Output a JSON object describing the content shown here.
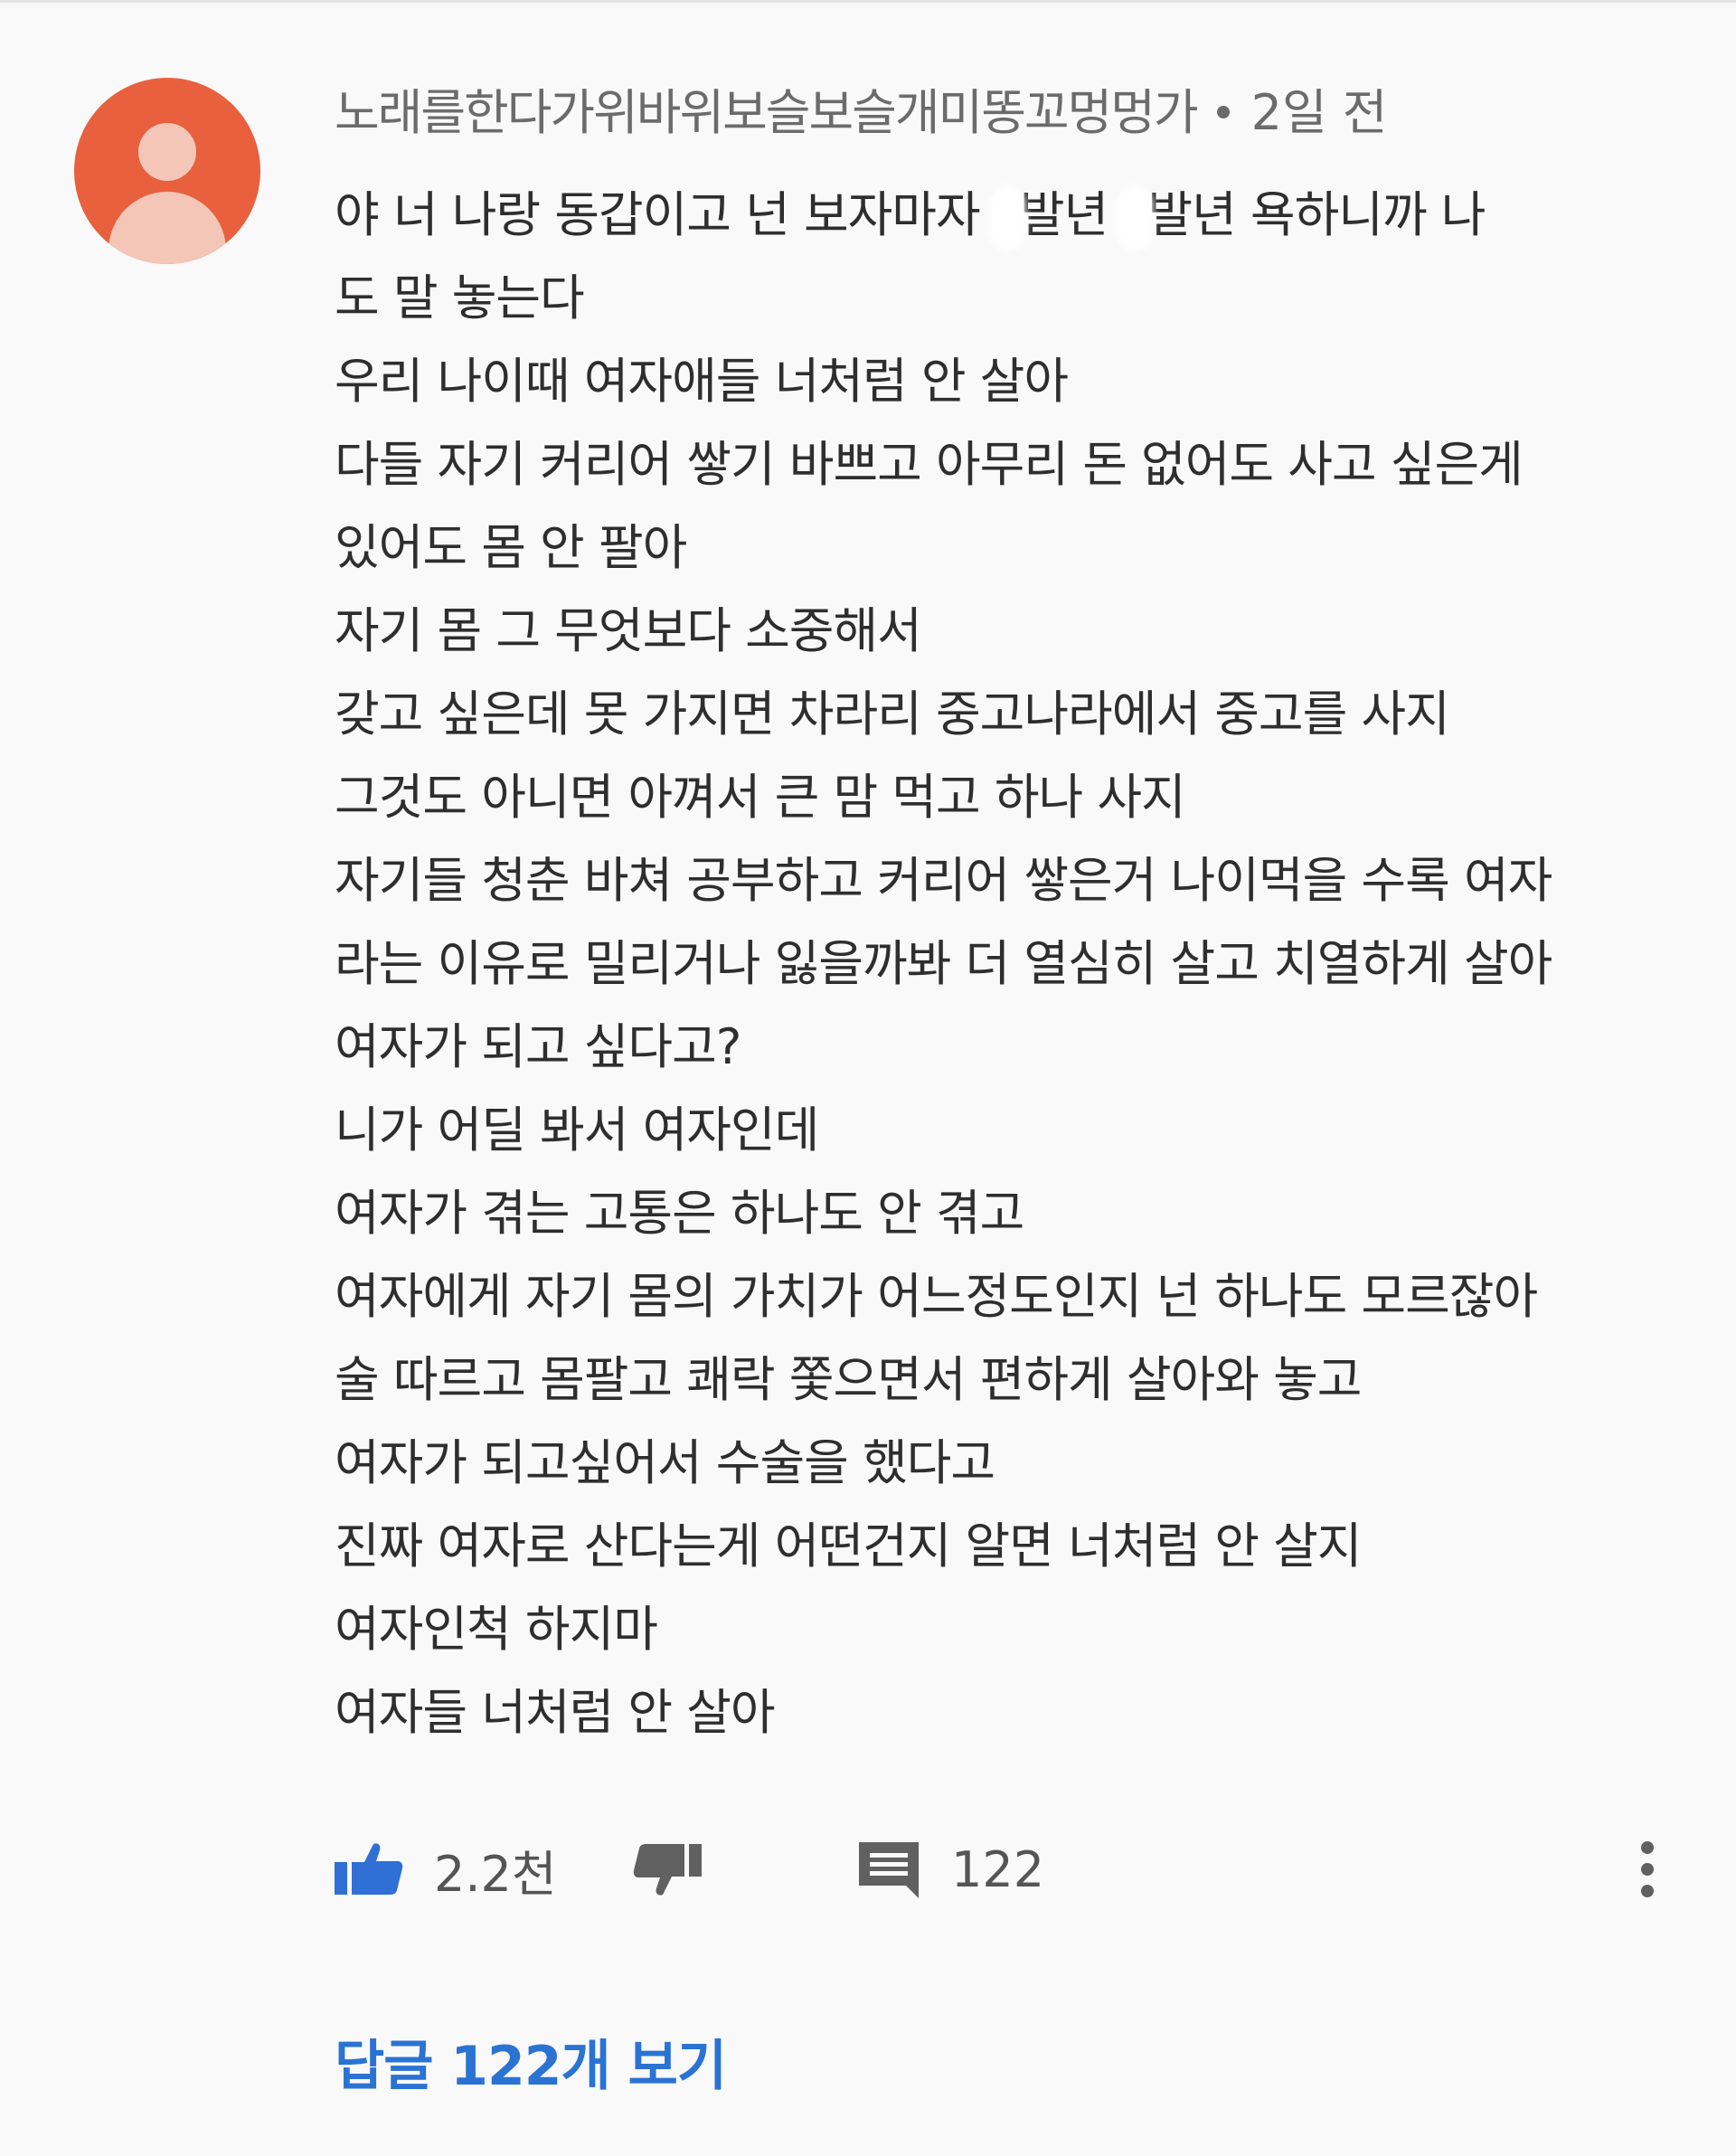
{
  "comment": {
    "author": "노래를한다가위바위보슬보슬개미똥꼬멍멍가",
    "separator": "•",
    "time": "2일 전",
    "lines": [
      [
        "야 너 나랑 동갑이고 넌 보자마자 ",
        "BLUR",
        "발년 ",
        "BLUR",
        "발년 욕하니까 나"
      ],
      "도 말 놓는다",
      "우리 나이때 여자애들 너처럼 안 살아",
      "다들 자기 커리어 쌓기 바쁘고 아무리 돈 없어도 사고 싶은게",
      "있어도 몸 안 팔아",
      "자기 몸 그 무엇보다 소중해서",
      "갖고 싶은데 못 가지면 차라리 중고나라에서 중고를 사지",
      "그것도 아니면 아껴서 큰 맘 먹고 하나 사지",
      "자기들 청춘 바쳐 공부하고 커리어 쌓은거 나이먹을 수록 여자",
      "라는 이유로 밀리거나 잃을까봐 더 열심히 살고 치열하게 살아",
      "여자가 되고 싶다고?",
      "니가 어딜 봐서 여자인데",
      "여자가 겪는 고통은 하나도 안 겪고",
      "여자에게 자기 몸의 가치가 어느정도인지 넌 하나도 모르잖아",
      "술 따르고 몸팔고 쾌락 쫓으면서 편하게 살아와 놓고",
      "여자가 되고싶어서 수술을 했다고",
      "진짜 여자로 산다는게 어떤건지 알면 너처럼 안 살지",
      "여자인척 하지마",
      "여자들 너처럼 안 살아"
    ]
  },
  "actions": {
    "likes": "2.2천",
    "replies_count": "122",
    "like_icon": "thumbs-up-icon",
    "dislike_icon": "thumbs-down-icon",
    "reply_icon": "comment-icon",
    "more_icon": "more-vertical-icon"
  },
  "replies_link": "답글 122개 보기",
  "colors": {
    "avatar": "#e8603d",
    "like_icon": "#2f6fd6",
    "link": "#2a73d3",
    "text": "#2e2e2e",
    "meta": "#6b6b6b"
  }
}
